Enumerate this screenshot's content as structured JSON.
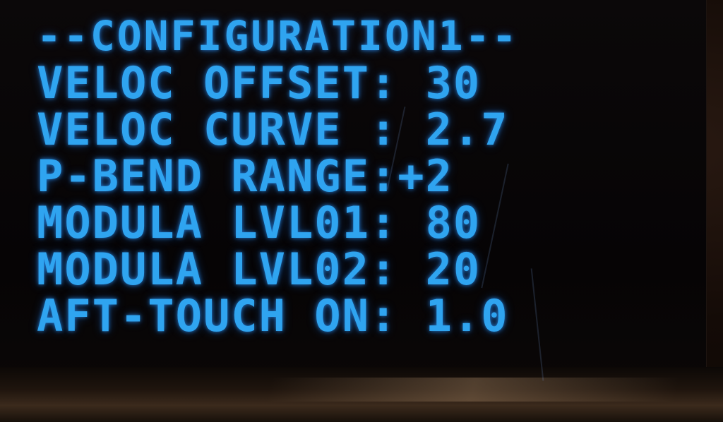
{
  "display": {
    "title": "--CONFIGURATION1--",
    "rows": [
      {
        "label": "VELOC OFFSET",
        "separator": ":",
        "value": "30"
      },
      {
        "label": "VELOC CURVE ",
        "separator": ":",
        "value": "2.7"
      },
      {
        "label": "P-BEND RANGE",
        "separator": ":",
        "value": "+2"
      },
      {
        "label": "MODULA LVL01",
        "separator": ":",
        "value": "80"
      },
      {
        "label": "MODULA LVL02",
        "separator": ":",
        "value": "20"
      },
      {
        "label": "AFT-TOUCH ON",
        "separator": ":",
        "value": "1.0"
      }
    ]
  },
  "colors": {
    "text": "#2fa4f0",
    "background": "#060405"
  }
}
